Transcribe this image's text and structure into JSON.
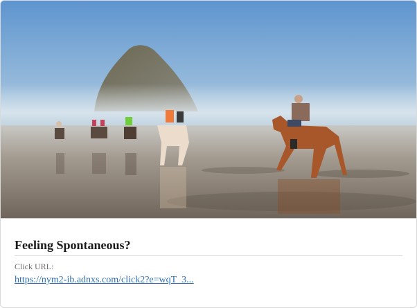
{
  "card": {
    "image_alt": "Horseback riders on a misty beach near a large sea stack",
    "title": "Feeling Spontaneous?",
    "click_url_label": "Click URL:",
    "click_url_text": "https://nym2-ib.adnxs.com/click2?e=wqT_3..."
  },
  "colors": {
    "sky_top": "#5e95cf",
    "sky_bottom": "#dbe8ef",
    "sand": "#8a7e72",
    "link": "#2f6fb0"
  }
}
